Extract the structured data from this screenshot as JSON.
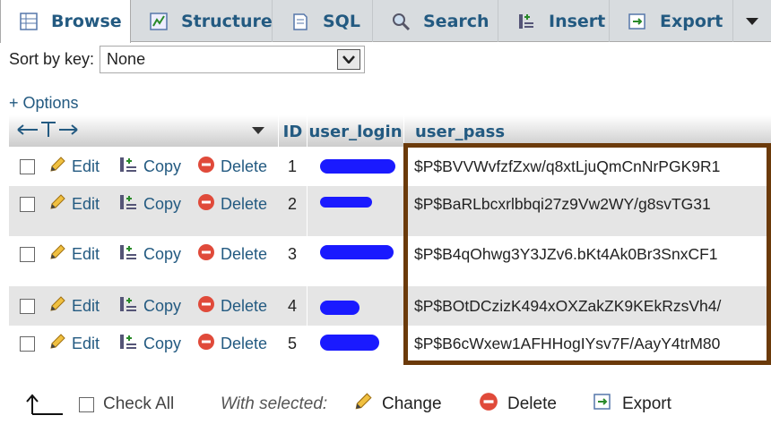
{
  "tabs": [
    {
      "label": "Browse",
      "icon": "browse-icon",
      "active": true
    },
    {
      "label": "Structure",
      "icon": "structure-icon",
      "active": false
    },
    {
      "label": "SQL",
      "icon": "sql-icon",
      "active": false
    },
    {
      "label": "Search",
      "icon": "search-icon",
      "active": false
    },
    {
      "label": "Insert",
      "icon": "insert-icon",
      "active": false
    },
    {
      "label": "Export",
      "icon": "export-icon",
      "active": false
    }
  ],
  "tab_more_icon": "chevron-down-icon",
  "sort": {
    "label": "Sort by key:",
    "value": "None"
  },
  "options_link": "+ Options",
  "columns": {
    "id": "ID",
    "login": "user_login",
    "pass": "user_pass"
  },
  "actions": {
    "edit": "Edit",
    "copy": "Copy",
    "delete": "Delete"
  },
  "rows": [
    {
      "id": "1",
      "pass": "$P$BVVWvfzfZxw/q8xtLjuQmCnNrPGK9R1"
    },
    {
      "id": "2",
      "pass": "$P$BaRLbcxrlbbqi27z9Vw2WY/g8svTG31"
    },
    {
      "id": "3",
      "pass": "$P$B4qOhwg3Y3JZv6.bKt4Ak0Br3SnxCF1"
    },
    {
      "id": "4",
      "pass": "$P$BOtDCzizK494xOXZakZK9KEkRzsVh4/"
    },
    {
      "id": "5",
      "pass": "$P$B6cWxew1AFHHogIYsv7F/AayY4trM80"
    }
  ],
  "bottom": {
    "check_all": "Check All",
    "with_selected": "With selected:",
    "change": "Change",
    "delete": "Delete",
    "export": "Export"
  },
  "colors": {
    "link": "#235a81",
    "highlight_border": "#6b3a0a",
    "redaction": "#1a1aff",
    "delete_red": "#e04a3a"
  }
}
